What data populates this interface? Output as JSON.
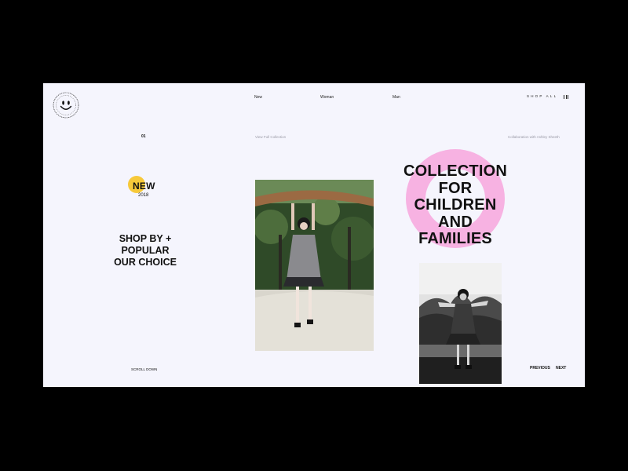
{
  "brand": {
    "logo_icon": "smiley-badge-icon",
    "colors": {
      "background": "#000000",
      "page": "#f5f5fd",
      "accent_yellow": "#f7c93a",
      "accent_pink": "#f7b2e2",
      "text": "#111111",
      "muted": "#9a9aa6"
    }
  },
  "nav": {
    "items": [
      {
        "label": "New"
      },
      {
        "label": "Woman"
      },
      {
        "label": "Man"
      }
    ],
    "shop_all": "SHOP ALL",
    "menu_icon": "hamburger-menu-icon"
  },
  "slide": {
    "index": "01",
    "view_collection": "View Full Collection",
    "collaboration": "Collaboration with Ashley Sheeth"
  },
  "new_badge": {
    "label": "NEW",
    "year": "2018"
  },
  "shop_by": {
    "line1": "SHOP BY",
    "plus": "+",
    "line2": "POPULAR",
    "line3": "OUR CHOICE"
  },
  "headline": {
    "lines": [
      "COLLECTION",
      "FOR",
      "CHILDREN",
      "AND",
      "FAMILIES"
    ]
  },
  "scroll": {
    "label": "SCROLL DOWN"
  },
  "pager": {
    "previous": "PREVIOUS",
    "next": "NEXT"
  }
}
